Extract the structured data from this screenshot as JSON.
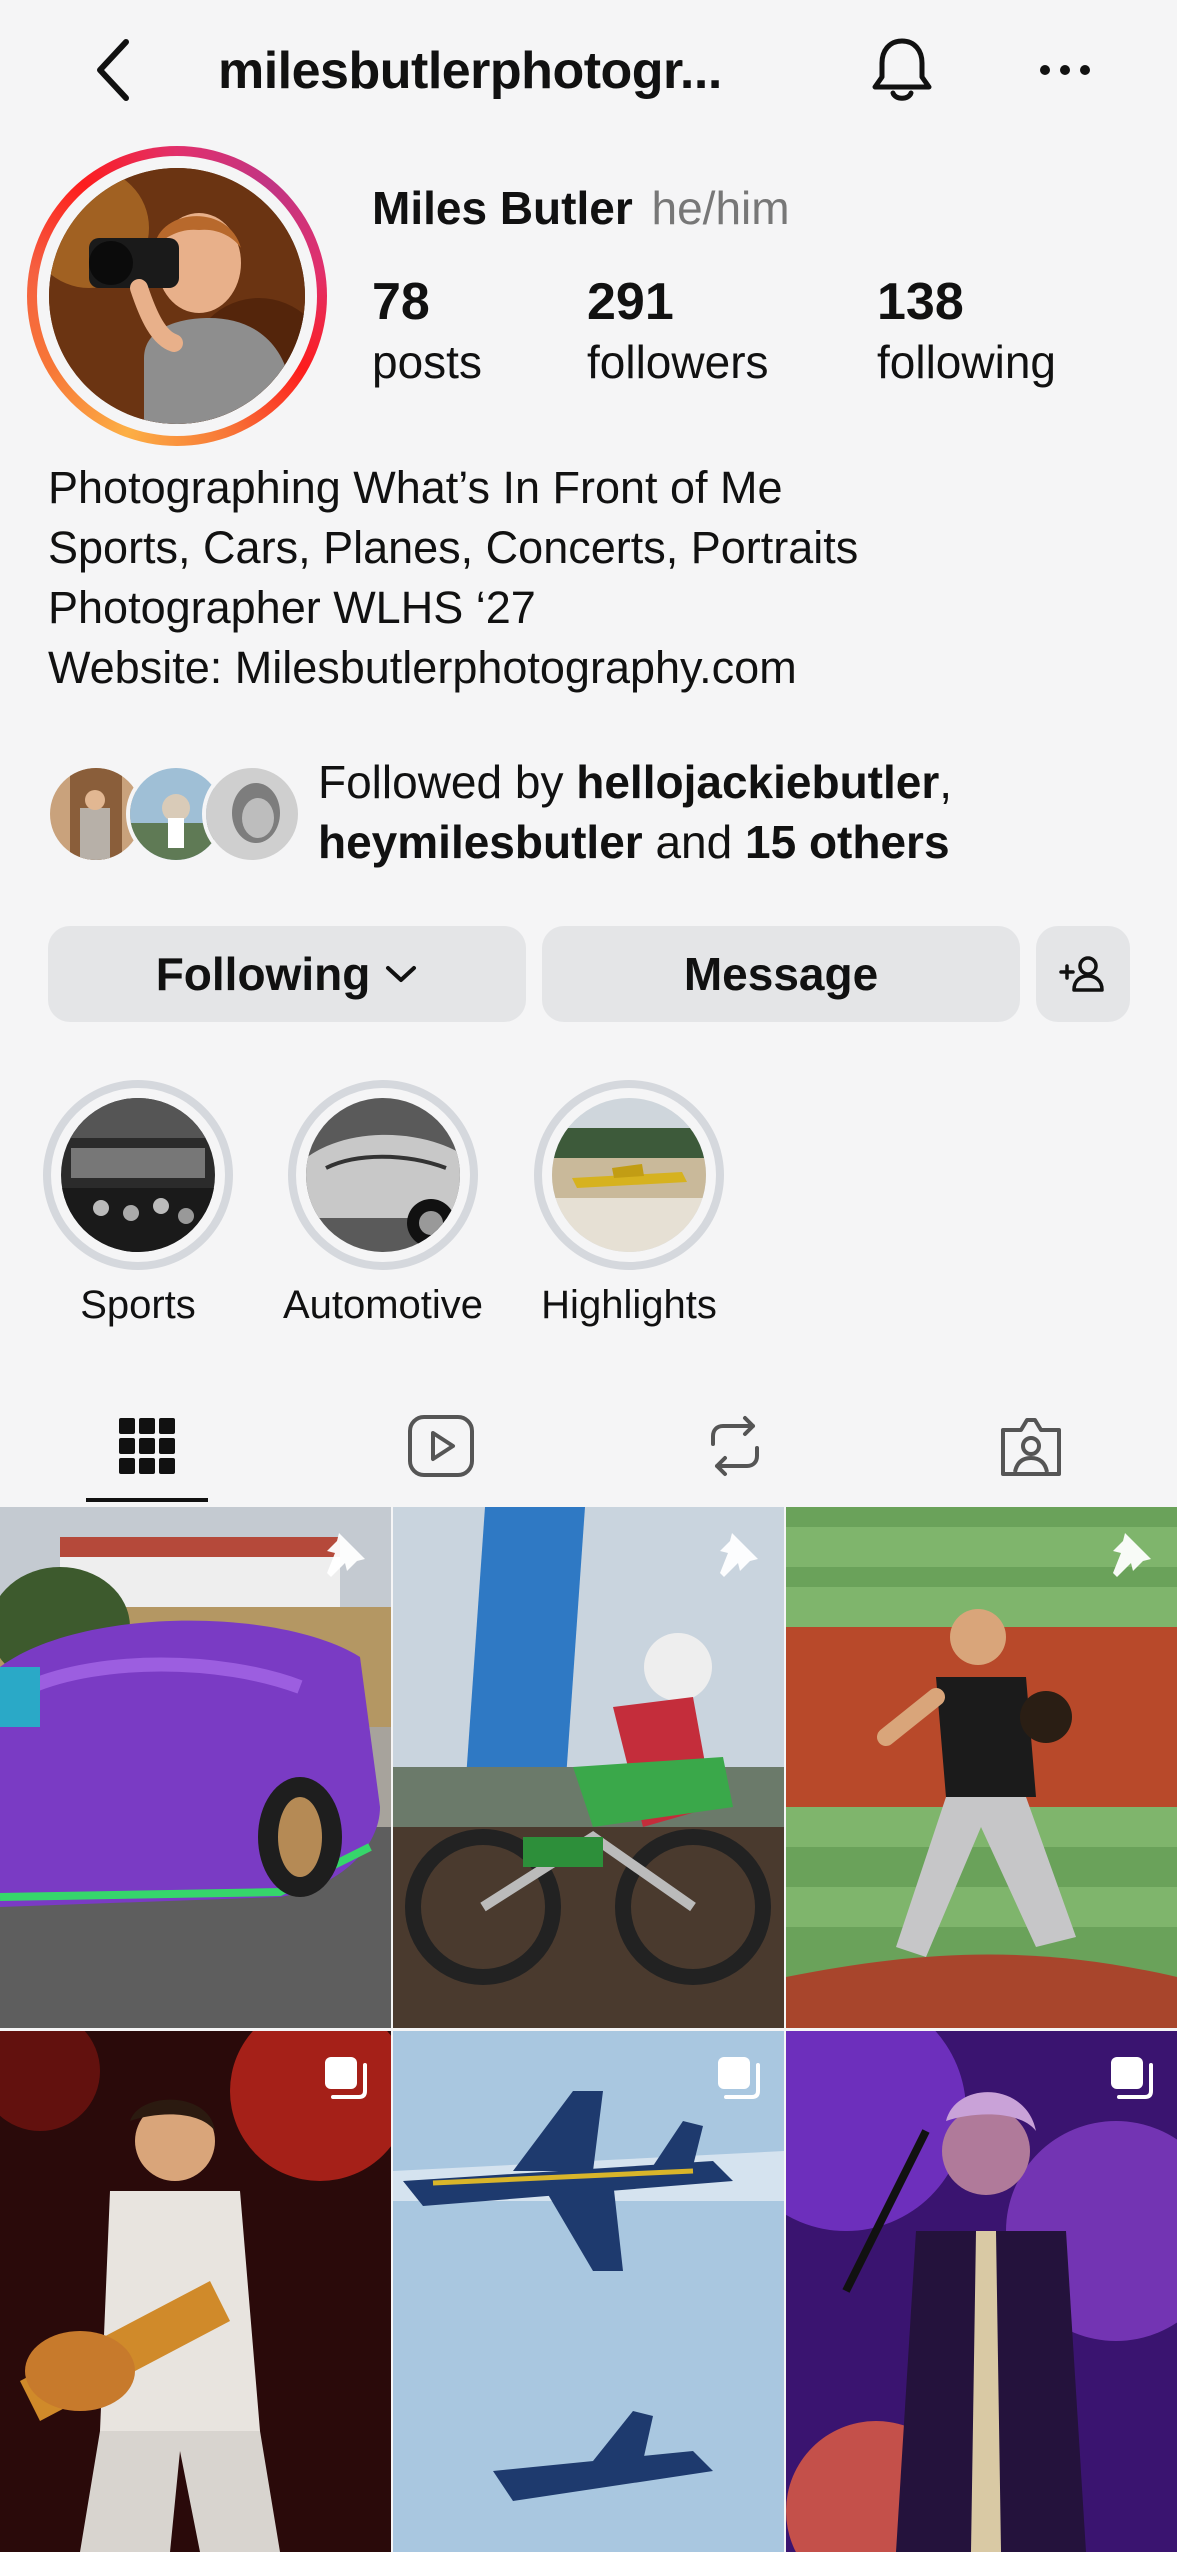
{
  "header": {
    "username": "milesbutlerphotogr..."
  },
  "profile": {
    "name": "Miles Butler",
    "pronouns": "he/him",
    "stats": [
      {
        "value": "78",
        "label": "posts"
      },
      {
        "value": "291",
        "label": "followers"
      },
      {
        "value": "138",
        "label": "following"
      }
    ],
    "bio": [
      "Photographing What’s In Front of Me",
      "Sports, Cars, Planes, Concerts, Portraits",
      "Photographer WLHS ‘27",
      "Website: Milesbutlerphotography.com"
    ]
  },
  "followed_by": {
    "prefix": "Followed by ",
    "user1": "hellojackiebutler",
    "comma": ",",
    "user2": "heymilesbutler",
    "middle": " and ",
    "others": "15 others"
  },
  "actions": {
    "following": "Following",
    "message": "Message"
  },
  "highlights": [
    {
      "label": "Sports"
    },
    {
      "label": "Automotive"
    },
    {
      "label": "Highlights"
    }
  ],
  "tabs": [
    "grid",
    "reels",
    "reposts",
    "tagged"
  ],
  "grid": [
    {
      "subject": "purple supercar",
      "badge": "pin-icon"
    },
    {
      "subject": "motocross rider",
      "badge": "pin-icon"
    },
    {
      "subject": "baseball pitcher",
      "badge": "pin-icon"
    },
    {
      "subject": "guitarist concert",
      "badge": "multiple-icon"
    },
    {
      "subject": "blue angels jets",
      "badge": "multiple-icon"
    },
    {
      "subject": "singer concert",
      "badge": "multiple-icon"
    }
  ]
}
